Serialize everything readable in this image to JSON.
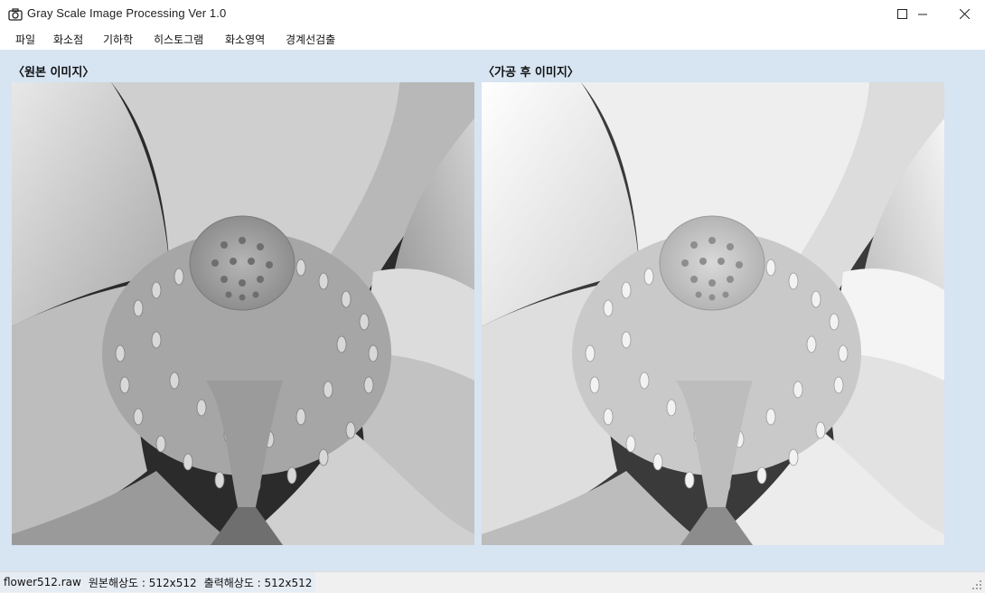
{
  "window": {
    "title": "Gray Scale Image Processing Ver 1.0",
    "app_icon": "camera-icon"
  },
  "menu": [
    {
      "label": "파일"
    },
    {
      "label": "화소점"
    },
    {
      "label": "기하학"
    },
    {
      "label": "히스토그램"
    },
    {
      "label": "화소영역"
    },
    {
      "label": "경계선검출"
    }
  ],
  "panels": {
    "original_label": "〈원본 이미지〉",
    "processed_label": "〈가공 후 이미지〉"
  },
  "status": {
    "filename": "flower512.raw",
    "input_resolution": "원본해상도 : 512x512",
    "output_resolution": "출력해상도 : 512x512"
  },
  "colors": {
    "client_background": "#d7e4f2",
    "status_panel": "#e6ecf4"
  }
}
